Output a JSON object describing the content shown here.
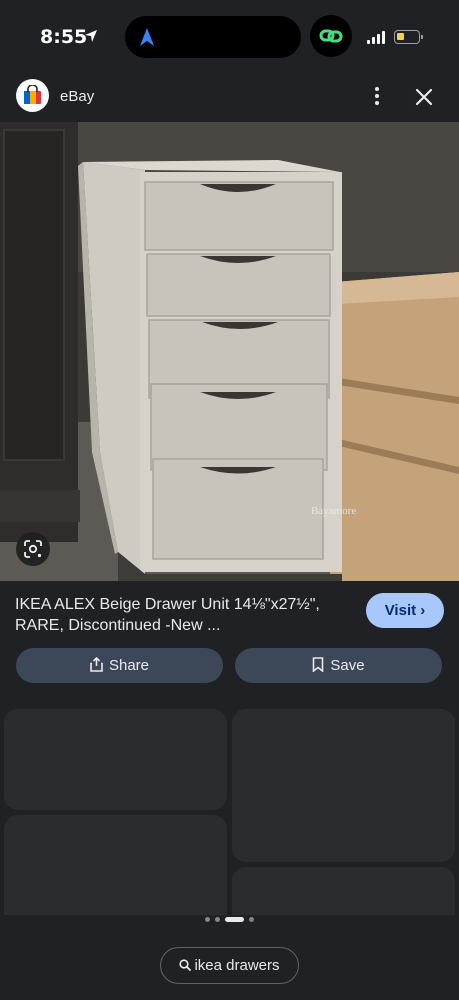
{
  "status_bar": {
    "time": "8:55"
  },
  "header": {
    "source_name": "eBay"
  },
  "image": {
    "watermark": "Bayamore"
  },
  "details": {
    "title_line1": "IKEA ALEX Beige Drawer Unit 14⅛\"x27½\",",
    "title_line2": "RARE, Discontinued -New ...",
    "visit_label": "Visit ›"
  },
  "actions": {
    "share_label": "Share",
    "save_label": "Save"
  },
  "pager": {
    "current_page": 3,
    "total_pages": 4
  },
  "search_chip": {
    "query": "ikea drawers"
  },
  "colors": {
    "background": "#202124",
    "visit_button": "#a8c7fa",
    "action_button": "#3c4758",
    "card": "#2b2c30"
  }
}
